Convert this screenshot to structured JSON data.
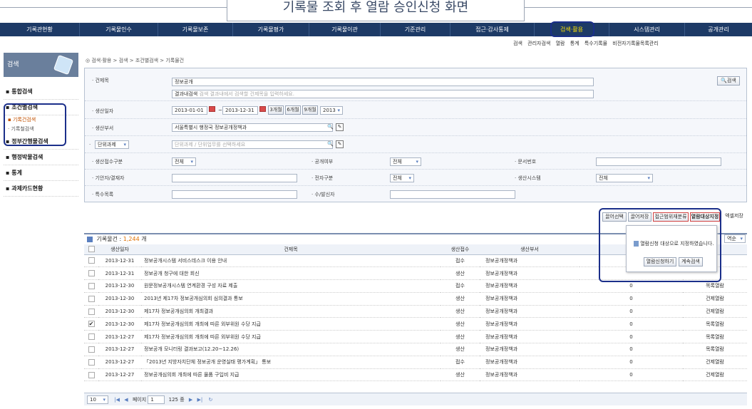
{
  "page_title": "기록물 조회 후 열람 승인신청 화면",
  "topnav": [
    "기록관현황",
    "기록물인수",
    "기록물보존",
    "기록물평가",
    "기록물이관",
    "기준관리",
    "접근·감사통제",
    "검색·활용",
    "시스템관리",
    "공개관리"
  ],
  "topnav_active": "검색·활용",
  "subnav": [
    "검색",
    "관리자검색",
    "열람",
    "통계",
    "특수기록물",
    "비전자기록물목록관리"
  ],
  "sidebar": {
    "head": "검색",
    "items": [
      {
        "label": "▪ 통합검색"
      },
      {
        "label": "▪ 조건별검색"
      },
      {
        "label": "▪ 정부간행물검색"
      },
      {
        "label": "▪ 행정박물검색"
      },
      {
        "label": "▪ 통계"
      },
      {
        "label": "▪ 과제카드현황"
      }
    ],
    "subitems": [
      "▪ 기록건검색",
      "· 기록철검색"
    ]
  },
  "breadcrumb": "◎ 검색·활용 > 검색 > 조건별검색 > 기록물건",
  "form": {
    "title_label": "· 건제목",
    "title_value": "정보공개",
    "result_search_label": "결과내검색",
    "result_search_placeholder": "검색 결과내에서 검색할 건제목을 입력하세요.",
    "search_button": "검색",
    "date_label": "· 생산일자",
    "date_from": "2013-01-01",
    "date_to": "2013-12-31",
    "date_sep": "~",
    "period_buttons": [
      "3개월",
      "6개월",
      "9개월"
    ],
    "year": "2013",
    "dept_label": "· 생산부서",
    "dept_value": "서울특별시 행정국 정보공개정책과",
    "task_label": "단위과제",
    "task_placeholder": "단위과제 / 단위업무를 선택하세요",
    "receive_label": "· 생산접수구분",
    "receive_value": "전체",
    "public_label": "· 공개여부",
    "public_value": "전체",
    "docno_label": "· 문서번호",
    "drafter_label": "· 기안자/결재자",
    "etype_label": "· 전자구분",
    "etype_value": "전체",
    "system_label": "· 생산시스템",
    "system_value": "전체",
    "special_label": "· 특수목록",
    "sender_label": "· 수/발신자"
  },
  "actions": [
    "끌어선택",
    "끌어저장",
    "접근범위재분류",
    "열람대상지정",
    "엑셀저장"
  ],
  "list": {
    "label": "기록물건 :",
    "count": "1,244",
    "unit": "개",
    "sort": "역순",
    "headers": [
      "생산일자",
      "건제목",
      "생산접수",
      "생산부서",
      "",
      ""
    ],
    "rows": [
      {
        "checked": "",
        "date": "2013-12-31",
        "title": "정보공개시스템 서비스데스크 이용 안내",
        "type": "접수",
        "dept": "정보공개정책과",
        "n": "",
        "view": ""
      },
      {
        "checked": "",
        "date": "2013-12-31",
        "title": "정보공개 청구에 대한 회신",
        "type": "생산",
        "dept": "정보공개정책과",
        "n": "",
        "view": ""
      },
      {
        "checked": "",
        "date": "2013-12-30",
        "title": "원문정보공개시스템 연계환경 구성 자료 제출",
        "type": "접수",
        "dept": "정보공개정책과",
        "n": "0",
        "view": "목록열람"
      },
      {
        "checked": "",
        "date": "2013-12-30",
        "title": "2013년 제17차 정보공개심의회 심의결과 통보",
        "type": "생산",
        "dept": "정보공개정책과",
        "n": "0",
        "view": "건제열람"
      },
      {
        "checked": "",
        "date": "2013-12-30",
        "title": "제17차 정보공개심의회 개최결과",
        "type": "생산",
        "dept": "정보공개정책과",
        "n": "0",
        "view": "건제열람"
      },
      {
        "checked": "✔",
        "date": "2013-12-30",
        "title": "제17차 정보공개심의회 개최에 따른 외부위원 수당 지급",
        "type": "생산",
        "dept": "정보공개정책과",
        "n": "0",
        "view": "목록열람"
      },
      {
        "checked": "",
        "date": "2013-12-27",
        "title": "제17차 정보공개심의회 개최에 따른 외부위원 수당 지급",
        "type": "생산",
        "dept": "정보공개정책과",
        "n": "0",
        "view": "목록열람"
      },
      {
        "checked": "",
        "date": "2013-12-27",
        "title": "정보공개 모니터링 결과보고(12.20~12.26)",
        "type": "생산",
        "dept": "정보공개정책과",
        "n": "0",
        "view": "목록열람"
      },
      {
        "checked": "",
        "date": "2013-12-27",
        "title": "「2013년 지방자치단체 정보공개 운영실태 평가계획」 통보",
        "type": "접수",
        "dept": "정보공개정책과",
        "n": "0",
        "view": "건제열람"
      },
      {
        "checked": "",
        "date": "2013-12-27",
        "title": "정보공개심의회 개최에 따른 물품 구입비 지급",
        "type": "생산",
        "dept": "정보공개정책과",
        "n": "0",
        "view": "건제열람"
      }
    ]
  },
  "pager": {
    "size": "10",
    "page_label": "페이지",
    "page": "1",
    "total": "125 중"
  },
  "popup": {
    "message": "열람신청 대상으로 지정하였습니다.",
    "btn_apply": "열람신청하기",
    "btn_continue": "계속검색"
  }
}
